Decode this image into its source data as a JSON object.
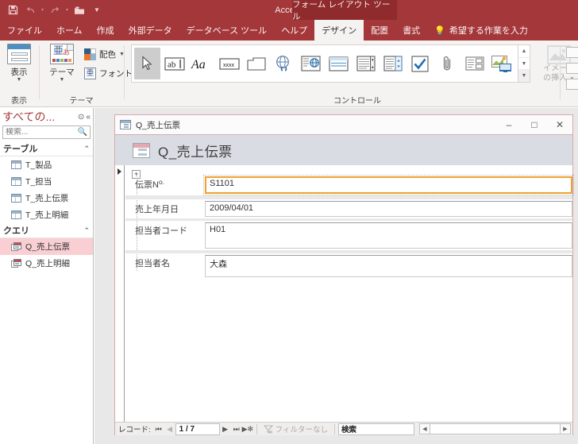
{
  "titlebar": {
    "app_title": "Access",
    "contextual_tab_title": "フォーム レイアウト ツール",
    "quick_access": [
      {
        "name": "save-icon",
        "glyph": "▤"
      },
      {
        "name": "undo-icon",
        "glyph": "↶"
      },
      {
        "name": "redo-icon",
        "glyph": "↷"
      },
      {
        "name": "print-preview-icon",
        "glyph": "▱"
      },
      {
        "name": "customize-qat-icon",
        "glyph": "▽"
      }
    ]
  },
  "ribbon": {
    "tabs": [
      {
        "label": "ファイル",
        "active": false
      },
      {
        "label": "ホーム",
        "active": false
      },
      {
        "label": "作成",
        "active": false
      },
      {
        "label": "外部データ",
        "active": false
      },
      {
        "label": "データベース ツール",
        "active": false
      },
      {
        "label": "ヘルプ",
        "active": false
      },
      {
        "label": "デザイン",
        "active": true
      },
      {
        "label": "配置",
        "active": false
      },
      {
        "label": "書式",
        "active": false
      }
    ],
    "tell_me": "希望する作業を入力",
    "groups": {
      "view": {
        "label": "表示",
        "button_label": "表示"
      },
      "theme": {
        "label": "テーマ",
        "theme_button_label": "テーマ",
        "colors_label": "配色",
        "fonts_label": "フォント",
        "font_glyph": "亜",
        "theme_glyph": "亜"
      },
      "controls": {
        "label": "コントロール",
        "items": [
          {
            "name": "select-tool-icon",
            "selected": true
          },
          {
            "name": "textbox-control-icon",
            "selected": false
          },
          {
            "name": "label-control-icon",
            "selected": false
          },
          {
            "name": "button-control-icon",
            "selected": false
          },
          {
            "name": "tab-control-icon",
            "selected": false
          },
          {
            "name": "hyperlink-control-icon",
            "selected": false
          },
          {
            "name": "web-browser-control-icon",
            "selected": false
          },
          {
            "name": "navigation-control-icon",
            "selected": false
          },
          {
            "name": "combo-box-control-icon",
            "selected": false
          },
          {
            "name": "list-box-control-icon",
            "selected": false
          },
          {
            "name": "checkbox-control-icon",
            "selected": false
          },
          {
            "name": "attachment-control-icon",
            "selected": false
          },
          {
            "name": "option-group-control-icon",
            "selected": false
          },
          {
            "name": "chart-control-icon",
            "selected": false
          }
        ],
        "insert_image_label": "イメージ\nの挿入"
      }
    }
  },
  "navpane": {
    "title": "すべての...",
    "search_placeholder": "検索...",
    "sections": [
      {
        "label": "テーブル",
        "items": [
          {
            "label": "T_製品",
            "type": "table",
            "selected": false
          },
          {
            "label": "T_担当",
            "type": "table",
            "selected": false
          },
          {
            "label": "T_売上伝票",
            "type": "table",
            "selected": false
          },
          {
            "label": "T_売上明細",
            "type": "table",
            "selected": false
          }
        ]
      },
      {
        "label": "クエリ",
        "items": [
          {
            "label": "Q_売上伝票",
            "type": "query",
            "selected": true
          },
          {
            "label": "Q_売上明細",
            "type": "query",
            "selected": false
          }
        ]
      }
    ]
  },
  "form_window": {
    "title": "Q_売上伝票",
    "header_title": "Q_売上伝票",
    "window_buttons": {
      "minimize": "–",
      "maximize": "□",
      "close": "✕"
    },
    "fields": [
      {
        "label": "伝票No.",
        "label_main": "伝票N",
        "label_sub": "o.",
        "value": "S1101",
        "focused": true
      },
      {
        "label": "売上年月日",
        "label_main": "売上年月日",
        "label_sub": "",
        "value": "2009/04/01",
        "focused": false
      },
      {
        "label": "担当者コード",
        "label_main": "担当者コード",
        "label_sub": "",
        "value": "H01",
        "focused": false
      },
      {
        "label": "担当者名",
        "label_main": "担当者名",
        "label_sub": "",
        "value": "大森",
        "focused": false
      }
    ],
    "record_nav": {
      "label": "レコード:",
      "first": "⏮",
      "prev": "◀",
      "position": "1 / 7",
      "next": "▶",
      "last": "⏭",
      "new_record": "▶✻",
      "filter_label": "フィルターなし",
      "search_label": "検索"
    }
  }
}
